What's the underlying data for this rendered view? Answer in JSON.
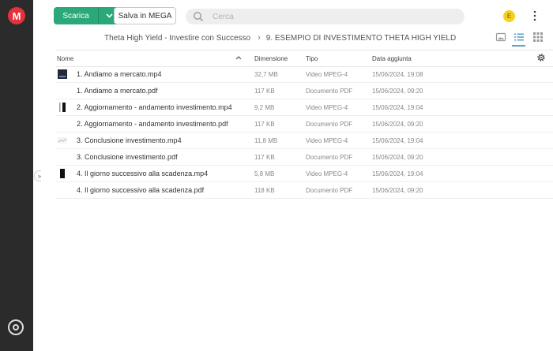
{
  "app": {
    "logo_letter": "M"
  },
  "toolbar": {
    "download_label": "Scarica",
    "save_label": "Salva in MEGA",
    "search_placeholder": "Cerca",
    "avatar_initial": "E"
  },
  "breadcrumb": {
    "parent": "Theta High Yield - Investire con Successo",
    "separator": "›",
    "current": "9. ESEMPIO DI INVESTIMENTO THETA HIGH YIELD"
  },
  "table": {
    "headers": {
      "name": "Nome",
      "size": "Dimensione",
      "type": "Tipo",
      "date": "Data aggiunta"
    },
    "rows": [
      {
        "name": "1. Andiamo a mercato.mp4",
        "size": "32,7 MB",
        "type": "Video MPEG-4",
        "date": "15/06/2024, 19:08",
        "thumb": "video-dark"
      },
      {
        "name": "1. Andiamo a mercato.pdf",
        "size": "117 KB",
        "type": "Documento PDF",
        "date": "15/06/2024, 09:20",
        "thumb": "none"
      },
      {
        "name": "2. Aggiornamento - andamento investimento.mp4",
        "size": "9,2 MB",
        "type": "Video MPEG-4",
        "date": "15/06/2024, 19:04",
        "thumb": "video-bars"
      },
      {
        "name": "2. Aggiornamento - andamento investimento.pdf",
        "size": "117 KB",
        "type": "Documento PDF",
        "date": "15/06/2024, 09:20",
        "thumb": "none"
      },
      {
        "name": "3. Conclusione investimento.mp4",
        "size": "11,8 MB",
        "type": "Video MPEG-4",
        "date": "15/06/2024, 19:04",
        "thumb": "video-light"
      },
      {
        "name": "3. Conclusione investimento.pdf",
        "size": "117 KB",
        "type": "Documento PDF",
        "date": "15/06/2024, 09:20",
        "thumb": "none"
      },
      {
        "name": "4. Il giorno successivo alla scadenza.mp4",
        "size": "5,8 MB",
        "type": "Video MPEG-4",
        "date": "15/06/2024, 19:04",
        "thumb": "video-black"
      },
      {
        "name": "4. Il giorno successivo alla scadenza.pdf",
        "size": "118 KB",
        "type": "Documento PDF",
        "date": "15/06/2024, 09:20",
        "thumb": "none"
      }
    ]
  },
  "colors": {
    "accent": "#2ba87a",
    "brand": "#e3323b",
    "sidebar": "#2b2b2b",
    "avatar": "#f5d11c"
  }
}
